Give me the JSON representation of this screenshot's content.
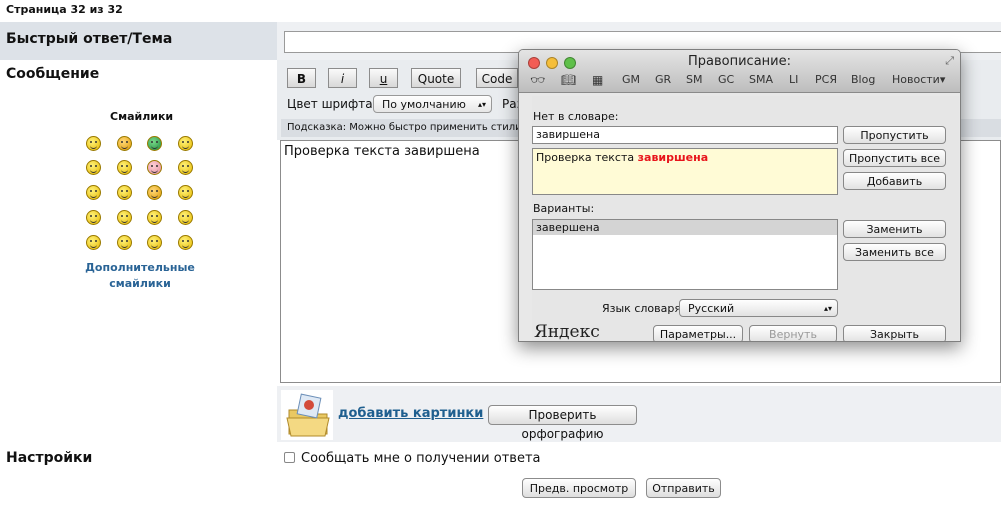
{
  "page_info": "Страница 32 из 32",
  "form": {
    "subject_label": "Быстрый ответ/Тема",
    "message_label": "Сообщение",
    "settings_label": "Настройки",
    "message_text": "Проверка текста завиршена"
  },
  "toolbar": {
    "bold": "B",
    "italic": "i",
    "underline": "u",
    "quote": "Quote",
    "code": "Code",
    "font_color_label": "Цвет шрифта:",
    "font_color_value": "По умолчанию",
    "size_partial": "Раз",
    "hint": "Подсказка: Можно быстро применить стили"
  },
  "smilies": {
    "title": "Смайлики",
    "more": "Дополнительные смайлики"
  },
  "attachments": {
    "add_pictures": "добавить картинки",
    "spellcheck_button": "Проверить орфографию"
  },
  "settings": {
    "notify_label": "Сообщать мне о получении ответа"
  },
  "actions": {
    "preview": "Предв. просмотр",
    "submit": "Отправить"
  },
  "spell_dialog": {
    "title": "Правописание:",
    "tools": [
      "GM",
      "GR",
      "SM",
      "GC",
      "SMA",
      "LI",
      "РСЯ",
      "Blog",
      "Новости▾"
    ],
    "not_in_dict_label": "Нет в словаре:",
    "word": "завиршена",
    "context_prefix": "Проверка текста ",
    "context_error": "завиршена",
    "variants_label": "Варианты:",
    "variant_1": "завершена",
    "dict_lang_label": "Язык словаря:",
    "dict_lang_value": "Русский",
    "btn_skip": "Пропустить",
    "btn_skip_all": "Пропустить все",
    "btn_add": "Добавить",
    "btn_replace": "Заменить",
    "btn_replace_all": "Заменить все",
    "btn_params": "Параметры...",
    "btn_revert": "Вернуть",
    "btn_close": "Закрыть",
    "logo": "Яндекс",
    "error_color": "#e8141b"
  }
}
